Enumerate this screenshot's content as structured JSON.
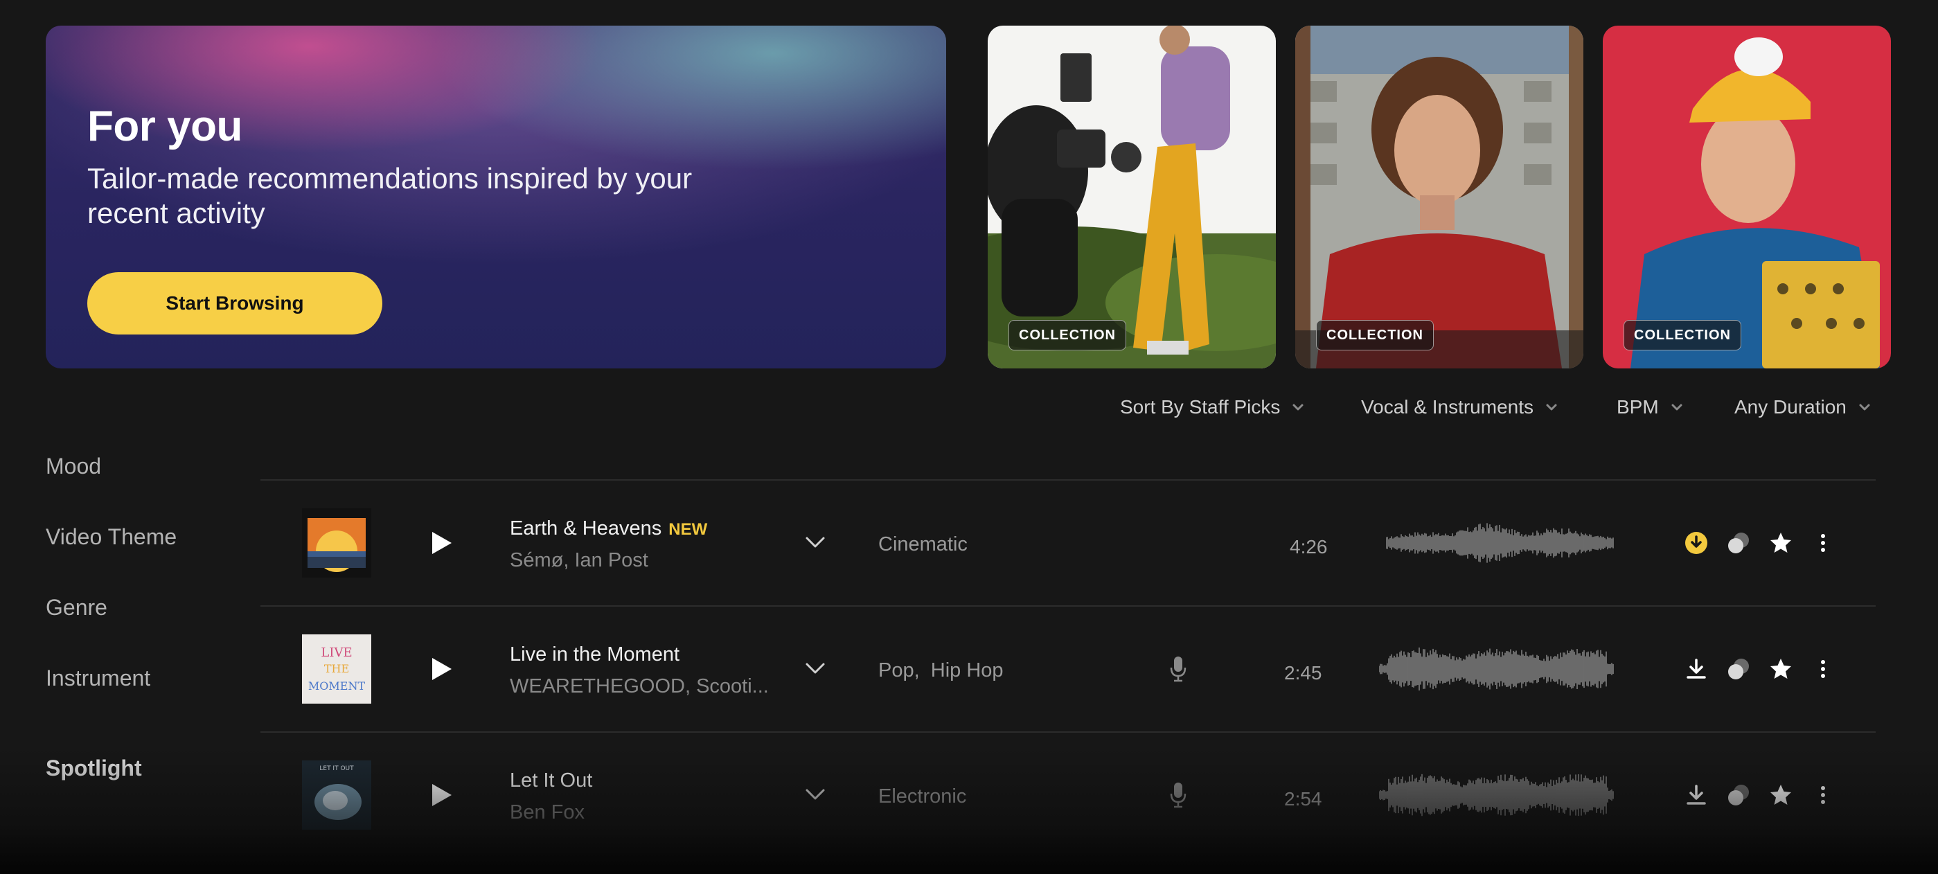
{
  "hero": {
    "title": "For you",
    "subtitle": "Tailor-made recommendations inspired by your recent activity",
    "button_label": "Start Browsing",
    "button_color": "#f7cf46"
  },
  "collections": [
    {
      "badge": "COLLECTION"
    },
    {
      "badge": "COLLECTION"
    },
    {
      "badge": "COLLECTION"
    }
  ],
  "filters": [
    {
      "label": "Sort By Staff Picks",
      "icon": "chevron-down-icon"
    },
    {
      "label": "Vocal & Instruments",
      "icon": "chevron-down-icon"
    },
    {
      "label": "BPM",
      "icon": "chevron-down-icon"
    },
    {
      "label": "Any Duration",
      "icon": "chevron-down-icon"
    }
  ],
  "sidebar": {
    "items": [
      {
        "label": "Mood"
      },
      {
        "label": "Video Theme"
      },
      {
        "label": "Genre"
      },
      {
        "label": "Instrument"
      },
      {
        "label": "Spotlight"
      }
    ]
  },
  "tracks": [
    {
      "title": "Earth & Heavens",
      "tag": "NEW",
      "artists": "Sémø, Ian Post",
      "genres": "Cinematic",
      "duration": "4:26",
      "downloaded": true,
      "has_vocals": false
    },
    {
      "title": "Live in the Moment",
      "tag": "",
      "artists": "WEARETHEGOOD, Scooti...",
      "genres": "Pop,  Hip Hop",
      "duration": "2:45",
      "downloaded": false,
      "has_vocals": true
    },
    {
      "title": "Let It Out",
      "tag": "",
      "artists": "Ben Fox",
      "genres": "Electronic",
      "duration": "2:54",
      "downloaded": false,
      "has_vocals": true
    }
  ],
  "colors": {
    "accent": "#f3c93e",
    "background": "#171717"
  }
}
